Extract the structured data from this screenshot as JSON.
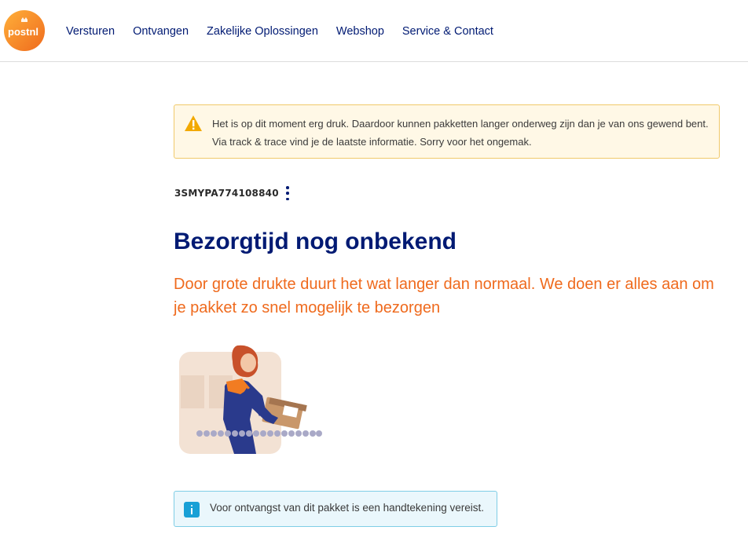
{
  "header": {
    "logo_text": "postnl",
    "nav": [
      "Versturen",
      "Ontvangen",
      "Zakelijke Oplossingen",
      "Webshop",
      "Service & Contact"
    ]
  },
  "warning": {
    "icon": "warning-triangle-icon",
    "text": "Het is op dit moment erg druk. Daardoor kunnen pakketten langer onderweg zijn dan je van ons gewend bent. Via track & trace vind je de laatste informatie. Sorry voor het ongemak."
  },
  "tracking": {
    "code": "3SMYPA774108840",
    "menu_icon": "kebab-menu-icon"
  },
  "status": {
    "headline": "Bezorgtijd nog onbekend",
    "subline": "Door grote drukte duurt het wat langer dan normaal. We doen er alles aan om je pakket zo snel mogelijk te bezorgen"
  },
  "info": {
    "icon": "info-icon",
    "text": "Voor ontvangst van dit pakket is een handtekening vereist."
  },
  "colors": {
    "brand_blue": "#001a73",
    "brand_orange": "#ef6a1d",
    "warning_bg": "#fff8e6",
    "info_bg": "#eaf7fc"
  }
}
